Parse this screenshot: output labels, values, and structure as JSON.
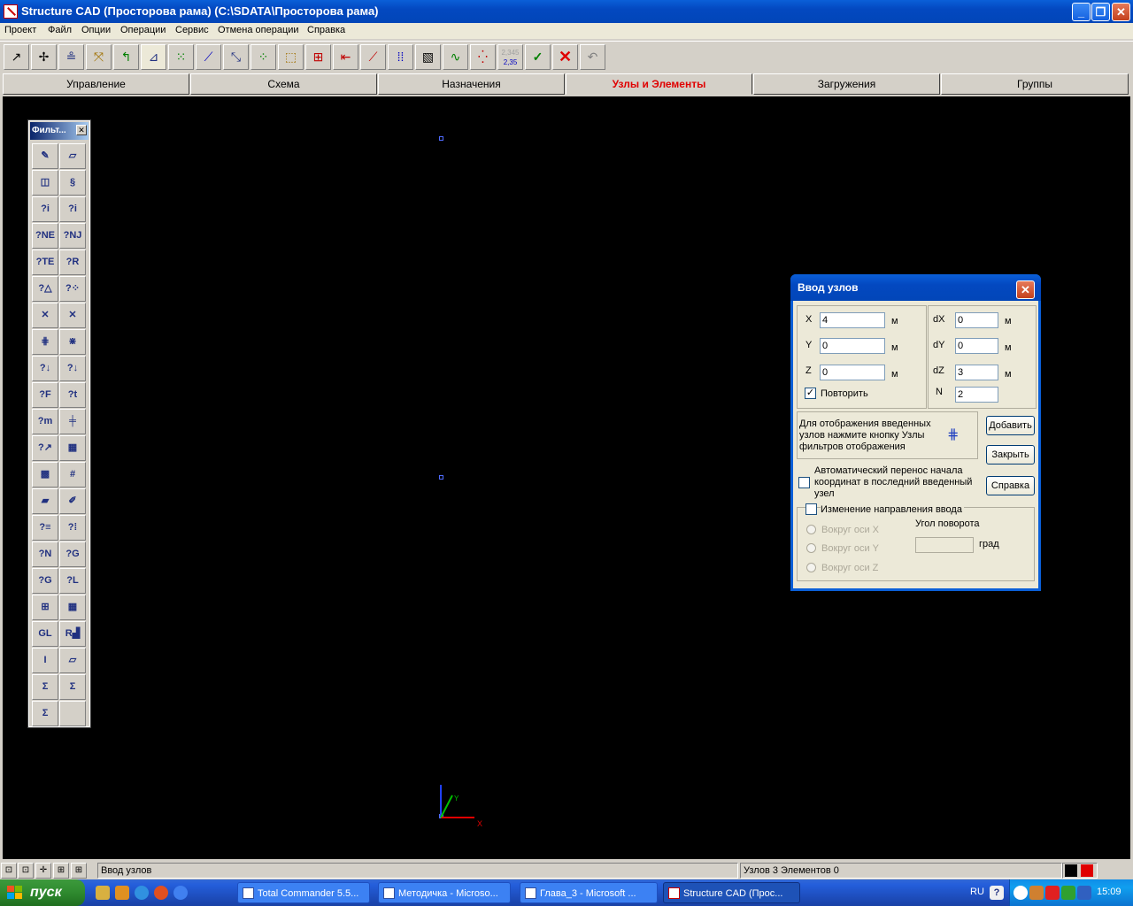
{
  "window": {
    "title": "Structure CAD (Просторова рама) (C:\\SDATA\\Просторова рама)",
    "buttons": [
      "_",
      "❐",
      "✕"
    ]
  },
  "menu": [
    "Проект",
    "Файл",
    "Опции",
    "Операции",
    "Сервис",
    "Отмена операции",
    "Справка"
  ],
  "toolbar_icons": [
    "select-node-icon",
    "rotate-view-icon",
    "stiffness-icon",
    "move-node-icon",
    "undo-node-icon",
    "axes-icon",
    "add-node-icon",
    "line-icon",
    "divide-icon",
    "copy-icon",
    "coordinates-icon",
    "grid-icon",
    "arrow-icon",
    "diagonal-icon",
    "array-icon",
    "hatch-icon",
    "curve-icon",
    "points-icon",
    "numbers-icon",
    "check-ok-icon",
    "delete-icon",
    "undo-icon"
  ],
  "toolbar_numbers_icon_text": {
    "top": "2,345",
    "bottom": "2,35"
  },
  "tabs": [
    {
      "label": "Управление"
    },
    {
      "label": "Схема"
    },
    {
      "label": "Назначения"
    },
    {
      "label": "Узлы и Элементы",
      "active": true
    },
    {
      "label": "Загружения"
    },
    {
      "label": "Группы"
    }
  ],
  "filter_panel": {
    "title": "Фильт...",
    "close": "✕",
    "icons": [
      {
        "name": "pencil-icon",
        "glyph": "✎"
      },
      {
        "name": "eraser-icon",
        "glyph": "▱"
      },
      {
        "name": "cube-icon",
        "glyph": "◫"
      },
      {
        "name": "spring-icon",
        "glyph": "§"
      },
      {
        "name": "node-number-icon",
        "glyph": "?i"
      },
      {
        "name": "element-number-icon",
        "glyph": "?i"
      },
      {
        "name": "node-ne-icon",
        "glyph": "?NE"
      },
      {
        "name": "node-nj-icon",
        "glyph": "?NJ"
      },
      {
        "name": "node-te-icon",
        "glyph": "?TE"
      },
      {
        "name": "node-r-icon",
        "glyph": "?R"
      },
      {
        "name": "support-icon",
        "glyph": "?△"
      },
      {
        "name": "hinge-icon",
        "glyph": "?⁘"
      },
      {
        "name": "axis-cross-icon",
        "glyph": "✕"
      },
      {
        "name": "axis-cross2-icon",
        "glyph": "✕"
      },
      {
        "name": "node-filter-icon",
        "glyph": "⋕"
      },
      {
        "name": "element-filter-icon",
        "glyph": "⋇"
      },
      {
        "name": "load-q-icon",
        "glyph": "?↓"
      },
      {
        "name": "load-p-icon",
        "glyph": "?↓"
      },
      {
        "name": "load-f-icon",
        "glyph": "?F"
      },
      {
        "name": "load-t-icon",
        "glyph": "?t"
      },
      {
        "name": "load-m-icon",
        "glyph": "?m"
      },
      {
        "name": "section-icon",
        "glyph": "╪"
      },
      {
        "name": "local-axes-icon",
        "glyph": "?↗"
      },
      {
        "name": "mesh-icon",
        "glyph": "▦"
      },
      {
        "name": "mesh-fill-icon",
        "glyph": "▩"
      },
      {
        "name": "grid-hash-icon",
        "glyph": "#"
      },
      {
        "name": "ruler-icon",
        "glyph": "▰"
      },
      {
        "name": "brush-icon",
        "glyph": "✐"
      },
      {
        "name": "layers-icon",
        "glyph": "?≡"
      },
      {
        "name": "nodes-dots-icon",
        "glyph": "?⁞"
      },
      {
        "name": "node-n-icon",
        "glyph": "?N"
      },
      {
        "name": "node-g-icon",
        "glyph": "?G"
      },
      {
        "name": "element-g-icon",
        "glyph": "?G"
      },
      {
        "name": "element-l-icon",
        "glyph": "?L"
      },
      {
        "name": "frame-grid-icon",
        "glyph": "⊞"
      },
      {
        "name": "red-grid-icon",
        "glyph": "▦"
      },
      {
        "name": "gl-icon",
        "glyph": "GL"
      },
      {
        "name": "bar-chart-icon",
        "glyph": "R▟"
      },
      {
        "name": "beam-g-icon",
        "glyph": "I"
      },
      {
        "name": "plate-icon",
        "glyph": "▱"
      },
      {
        "name": "sum-nodes-icon",
        "glyph": "Σ"
      },
      {
        "name": "sum-table-icon",
        "glyph": "Σ"
      },
      {
        "name": "sum-points-icon",
        "glyph": "Σ"
      }
    ]
  },
  "canvas": {
    "axis_x": "X",
    "axis_y": "Y"
  },
  "dialog": {
    "title": "Ввод узлов",
    "fields": {
      "x_label": "X",
      "x_value": "4",
      "x_unit": "м",
      "y_label": "Y",
      "y_value": "0",
      "y_unit": "м",
      "z_label": "Z",
      "z_value": "0",
      "z_unit": "м",
      "dx_label": "dX",
      "dx_value": "0",
      "dx_unit": "м",
      "dy_label": "dY",
      "dy_value": "0",
      "dy_unit": "м",
      "dz_label": "dZ",
      "dz_value": "3",
      "dz_unit": "м",
      "n_label": "N",
      "n_value": "2"
    },
    "repeat_label": "Повторить",
    "repeat_checked": true,
    "info_text_1": "Для отображения введенных",
    "info_text_2": "узлов нажмите кнопку Узлы",
    "info_text_3": "фильтров отображения",
    "btn_add": "Добавить",
    "btn_close": "Закрыть",
    "btn_help": "Справка",
    "auto_transfer_1": "Автоматический перенос начала",
    "auto_transfer_2": "координат в последний введенный",
    "auto_transfer_3": "узел",
    "direction_label": "Изменение направления ввода",
    "radio_x": "Вокруг оси X",
    "radio_y": "Вокруг оси Y",
    "radio_z": "Вокруг оси Z",
    "angle_label": "Угол поворота",
    "angle_unit": "град"
  },
  "status": {
    "left": "Ввод узлов",
    "right": "Узлов 3 Элементов 0"
  },
  "taskbar": {
    "start": "пуск",
    "tasks": [
      {
        "label": "Total Commander 5.5..."
      },
      {
        "label": "Методичка - Microso..."
      },
      {
        "label": "Глава_3 - Microsoft ..."
      },
      {
        "label": "Structure CAD (Прос...",
        "active": true
      }
    ],
    "lang": "RU",
    "clock": "15:09"
  }
}
